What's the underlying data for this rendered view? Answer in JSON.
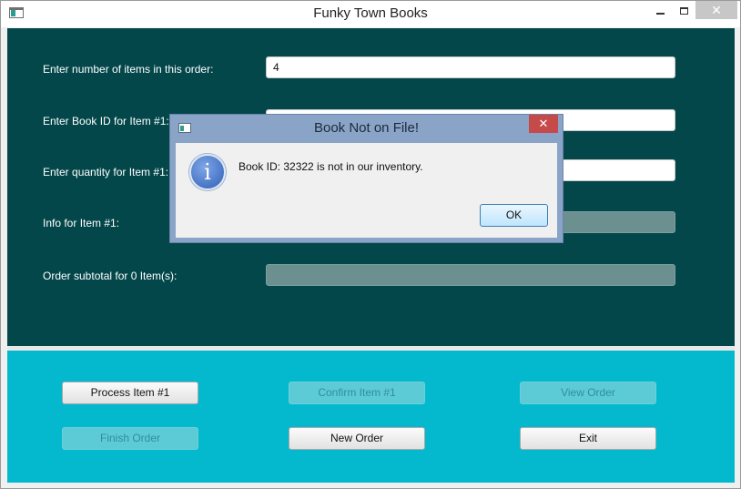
{
  "window": {
    "title": "Funky Town Books"
  },
  "form": {
    "num_items_label": "Enter number of items in this order:",
    "num_items_value": "4",
    "book_id_label": "Enter Book ID for Item #1:",
    "book_id_value": "",
    "quantity_label": "Enter quantity for Item #1:",
    "quantity_value": "",
    "info_label": "Info for Item #1:",
    "info_value": "",
    "subtotal_label": "Order subtotal for 0 Item(s):",
    "subtotal_value": ""
  },
  "buttons": {
    "process_item": "Process Item #1",
    "confirm_item": "Confirm Item #1",
    "view_order": "View Order",
    "finish_order": "Finish Order",
    "new_order": "New Order",
    "exit": "Exit"
  },
  "dialog": {
    "title": "Book Not on File!",
    "message": "Book ID: 32322 is not in our inventory.",
    "ok_label": "OK",
    "icon": "info-icon"
  },
  "colors": {
    "form_panel_bg": "#04474b",
    "button_panel_bg": "#04b9ce",
    "dialog_frame": "#8aa4c8",
    "close_red": "#c74a4a"
  }
}
